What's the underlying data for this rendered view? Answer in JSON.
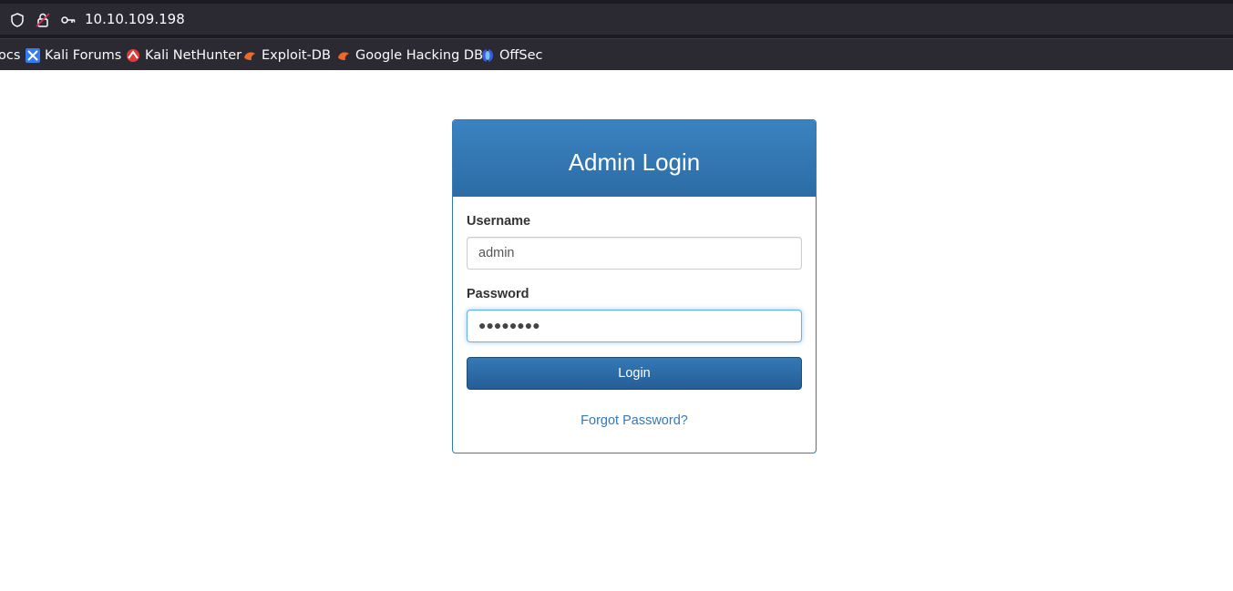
{
  "browser": {
    "url": "10.10.109.198",
    "bookmarks": [
      {
        "label": "ocs",
        "icon": "docs-favicon"
      },
      {
        "label": "Kali Forums",
        "icon": "kali-forums-favicon"
      },
      {
        "label": "Kali NetHunter",
        "icon": "kali-nethunter-favicon"
      },
      {
        "label": "Exploit-DB",
        "icon": "exploit-db-favicon"
      },
      {
        "label": "Google Hacking DB",
        "icon": "google-hacking-db-favicon"
      },
      {
        "label": "OffSec",
        "icon": "offsec-favicon"
      }
    ]
  },
  "login": {
    "title": "Admin Login",
    "username_label": "Username",
    "username_value": "admin",
    "password_label": "Password",
    "password_mask": "●●●●●●●●",
    "submit_label": "Login",
    "forgot_label": "Forgot Password?"
  },
  "colors": {
    "primary": "#337ab7",
    "chrome_bg": "#2b2a33",
    "focus_ring": "#66afe9"
  }
}
